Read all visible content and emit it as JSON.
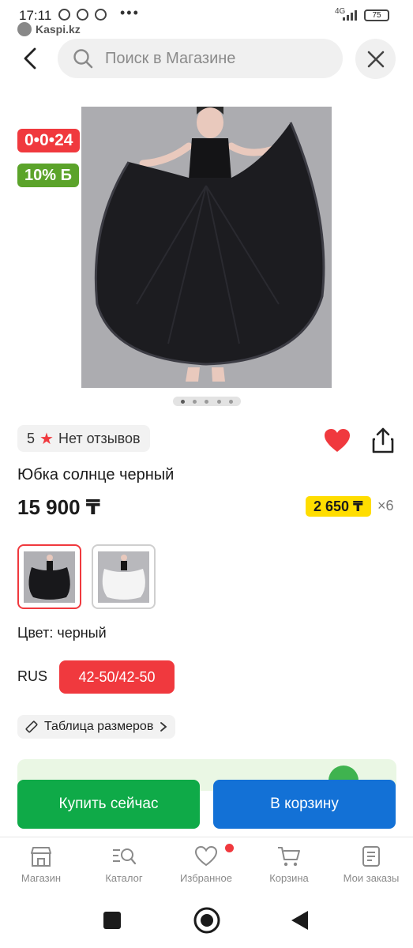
{
  "status_bar": {
    "time": "17:11",
    "network": "4G",
    "battery": "75",
    "more": "•••"
  },
  "mini_app": {
    "name": "Kaspi.kz"
  },
  "header": {
    "search_placeholder": "Поиск в Магазине",
    "icons": [
      "back-arrow-icon",
      "search-icon",
      "close-icon"
    ]
  },
  "badges": {
    "timer": "0•0•24",
    "percent": "10% Б"
  },
  "gallery": {
    "count": 5,
    "active": 0
  },
  "product": {
    "rating": "5",
    "reviews": "Нет отзывов",
    "title": "Юбка солнце черный",
    "price": "15 900 ₸",
    "installment": "2 650 ₸",
    "installment_months": "×6"
  },
  "variants": {
    "color_label": "Цвет: черный",
    "size_system": "RUS",
    "size_value": "42-50/42-50",
    "size_table": "Таблица размеров"
  },
  "actions": {
    "buy_now": "Купить сейчас",
    "add_to_cart": "В корзину"
  },
  "bottom_nav": {
    "items": [
      {
        "label": "Магазин",
        "icon": "shop-icon"
      },
      {
        "label": "Каталог",
        "icon": "catalog-icon"
      },
      {
        "label": "Избранное",
        "icon": "heart-icon"
      },
      {
        "label": "Корзина",
        "icon": "cart-icon"
      },
      {
        "label": "Мои заказы",
        "icon": "orders-icon"
      }
    ]
  },
  "colors": {
    "red": "#f0393e",
    "green": "#0faa48",
    "blue": "#1371d6",
    "yellow": "#ffdd00",
    "badge_green": "#5ba32a"
  }
}
